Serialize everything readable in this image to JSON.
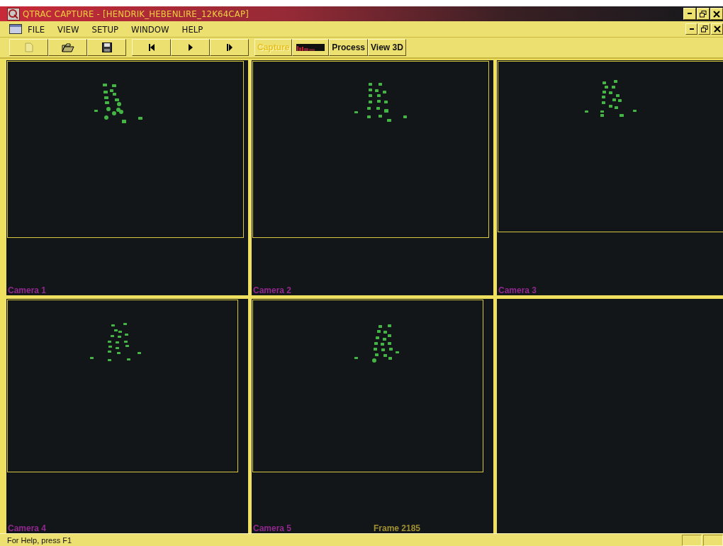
{
  "window": {
    "title": "QTRAC CAPTURE - [HENDRIK_HEBENLIRE_12K64CAP]"
  },
  "menu": [
    "FILE",
    "VIEW",
    "SETUP",
    "WINDOW",
    "HELP"
  ],
  "toolbar": [
    {
      "kind": "icon",
      "disabled": true
    },
    {
      "kind": "icon",
      "disabled": false
    },
    {
      "kind": "icon",
      "disabled": false
    },
    {
      "kind": "icon",
      "disabled": false
    },
    {
      "kind": "icon",
      "disabled": false
    },
    {
      "kind": "icon",
      "disabled": false
    },
    {
      "kind": "text",
      "label": "Capture",
      "disabled": true
    },
    {
      "kind": "meter"
    },
    {
      "kind": "text",
      "label": "Process",
      "disabled": false
    },
    {
      "kind": "text",
      "label": "View 3D",
      "disabled": false
    }
  ],
  "cameras": [
    {
      "label": "Camera 1"
    },
    {
      "label": "Camera 2"
    },
    {
      "label": "Camera 3"
    },
    {
      "label": "Camera 4"
    },
    {
      "label": "Camera 5",
      "frame": "Frame 2185"
    }
  ],
  "status_bar": {
    "text": "For Help, press F1"
  }
}
